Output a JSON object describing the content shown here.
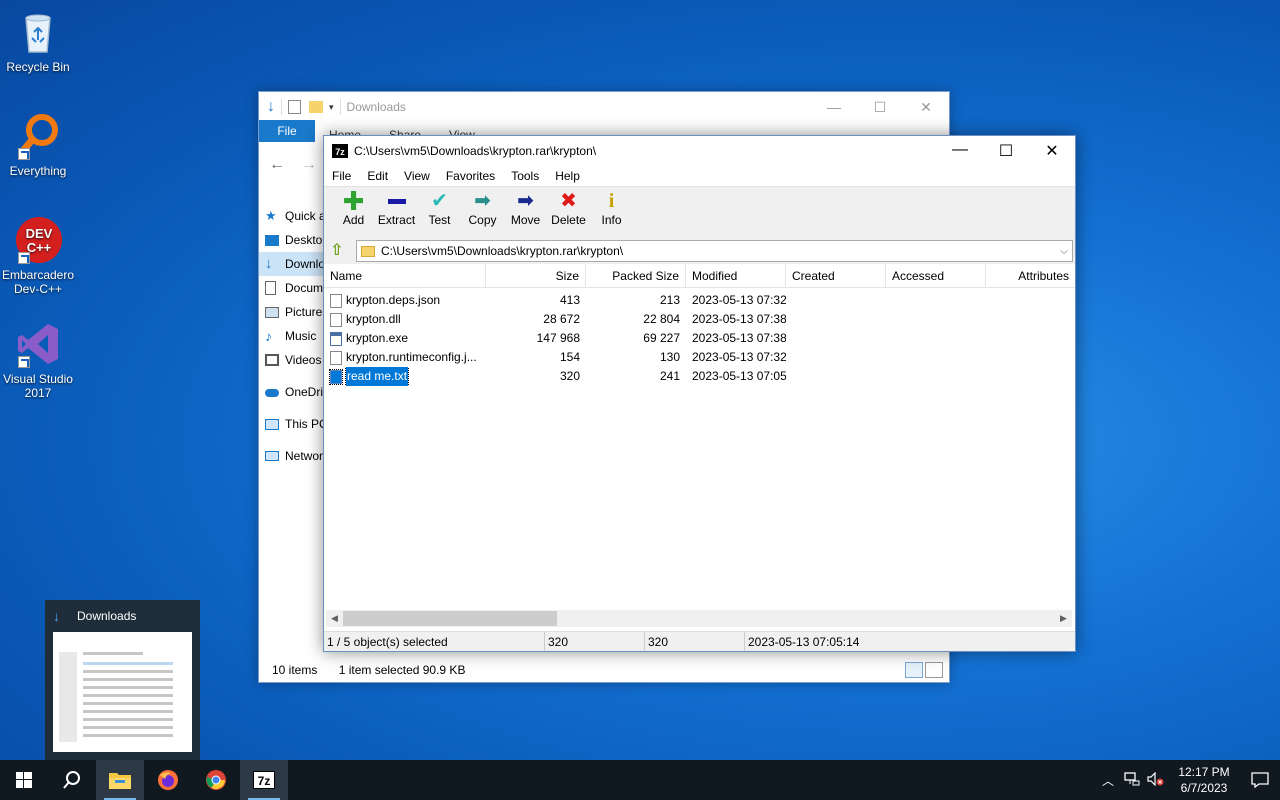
{
  "desktop": {
    "icons": [
      {
        "label": "Recycle Bin"
      },
      {
        "label": "Everything"
      },
      {
        "label": "Embarcadero Dev-C++",
        "logo_text": "DEV C++"
      },
      {
        "label": "Visual Studio 2017"
      }
    ]
  },
  "explorer": {
    "title": "Downloads",
    "ribbon": {
      "file_tab": "File",
      "tabs": [
        "Home",
        "Share",
        "View"
      ]
    },
    "nav": [
      "Quick access",
      "Desktop",
      "Downloads",
      "Documents",
      "Pictures",
      "Music",
      "Videos",
      "OneDrive",
      "This PC",
      "Network"
    ],
    "status": {
      "items": "10 items",
      "selected": "1 item selected  90.9 KB"
    }
  },
  "zip": {
    "title": "C:\\Users\\vm5\\Downloads\\krypton.rar\\krypton\\",
    "logo": "7z",
    "menu": [
      "File",
      "Edit",
      "View",
      "Favorites",
      "Tools",
      "Help"
    ],
    "toolbar": [
      {
        "label": "Add",
        "icon": "plus-icon",
        "color": "#2fa32f"
      },
      {
        "label": "Extract",
        "icon": "minus-icon",
        "color": "#1a1aa8"
      },
      {
        "label": "Test",
        "icon": "check-icon",
        "color": "#2bb7b7"
      },
      {
        "label": "Copy",
        "icon": "arrow-right-icon",
        "color": "#2a8f8f"
      },
      {
        "label": "Move",
        "icon": "arrow-right-icon",
        "color": "#1a2a8f"
      },
      {
        "label": "Delete",
        "icon": "x-icon",
        "color": "#e01a1a"
      },
      {
        "label": "Info",
        "icon": "info-icon",
        "color": "#c8a000"
      }
    ],
    "address": "C:\\Users\\vm5\\Downloads\\krypton.rar\\krypton\\",
    "columns": [
      "Name",
      "Size",
      "Packed Size",
      "Modified",
      "Created",
      "Accessed",
      "Attributes"
    ],
    "files": [
      {
        "name": "krypton.deps.json",
        "size": "413",
        "packed": "213",
        "modified": "2023-05-13 07:32",
        "type": "generic"
      },
      {
        "name": "krypton.dll",
        "size": "28 672",
        "packed": "22 804",
        "modified": "2023-05-13 07:38",
        "type": "generic"
      },
      {
        "name": "krypton.exe",
        "size": "147 968",
        "packed": "69 227",
        "modified": "2023-05-13 07:38",
        "type": "exe"
      },
      {
        "name": "krypton.runtimeconfig.j...",
        "size": "154",
        "packed": "130",
        "modified": "2023-05-13 07:32",
        "type": "generic"
      },
      {
        "name": "read me.txt",
        "size": "320",
        "packed": "241",
        "modified": "2023-05-13 07:05",
        "type": "txt",
        "selected": true
      }
    ],
    "status": {
      "selection": "1 / 5 object(s) selected",
      "size": "320",
      "packed": "320",
      "modified": "2023-05-13 07:05:14"
    }
  },
  "thumbnail": {
    "title": "Downloads"
  },
  "taskbar": {
    "apps": [
      "start-icon",
      "search-icon",
      "file-explorer-icon",
      "firefox-icon",
      "chrome-icon",
      "7zip-icon"
    ],
    "clock_time": "12:17 PM",
    "clock_date": "6/7/2023"
  }
}
